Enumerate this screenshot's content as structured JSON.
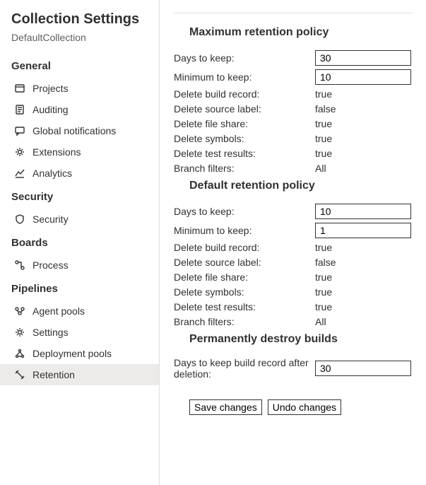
{
  "sidebar": {
    "title": "Collection Settings",
    "subtitle": "DefaultCollection",
    "sections": {
      "general": {
        "label": "General",
        "items": [
          {
            "label": "Projects"
          },
          {
            "label": "Auditing"
          },
          {
            "label": "Global notifications"
          },
          {
            "label": "Extensions"
          },
          {
            "label": "Analytics"
          }
        ]
      },
      "security": {
        "label": "Security",
        "items": [
          {
            "label": "Security"
          }
        ]
      },
      "boards": {
        "label": "Boards",
        "items": [
          {
            "label": "Process"
          }
        ]
      },
      "pipelines": {
        "label": "Pipelines",
        "items": [
          {
            "label": "Agent pools"
          },
          {
            "label": "Settings"
          },
          {
            "label": "Deployment pools"
          },
          {
            "label": "Retention"
          }
        ]
      }
    }
  },
  "main": {
    "maxPolicy": {
      "heading": "Maximum retention policy",
      "daysLabel": "Days to keep:",
      "daysValue": "30",
      "minLabel": "Minimum to keep:",
      "minValue": "10",
      "rows": [
        {
          "label": "Delete build record:",
          "value": "true"
        },
        {
          "label": "Delete source label:",
          "value": "false"
        },
        {
          "label": "Delete file share:",
          "value": "true"
        },
        {
          "label": "Delete symbols:",
          "value": "true"
        },
        {
          "label": "Delete test results:",
          "value": "true"
        },
        {
          "label": "Branch filters:",
          "value": "All"
        }
      ]
    },
    "defaultPolicy": {
      "heading": "Default retention policy",
      "daysLabel": "Days to keep:",
      "daysValue": "10",
      "minLabel": "Minimum to keep:",
      "minValue": "1",
      "rows": [
        {
          "label": "Delete build record:",
          "value": "true"
        },
        {
          "label": "Delete source label:",
          "value": "false"
        },
        {
          "label": "Delete file share:",
          "value": "true"
        },
        {
          "label": "Delete symbols:",
          "value": "true"
        },
        {
          "label": "Delete test results:",
          "value": "true"
        },
        {
          "label": "Branch filters:",
          "value": "All"
        }
      ]
    },
    "destroy": {
      "heading": "Permanently destroy builds",
      "daysLabel": "Days to keep build record after deletion:",
      "daysValue": "30"
    },
    "buttons": {
      "save": "Save changes",
      "undo": "Undo changes"
    }
  }
}
